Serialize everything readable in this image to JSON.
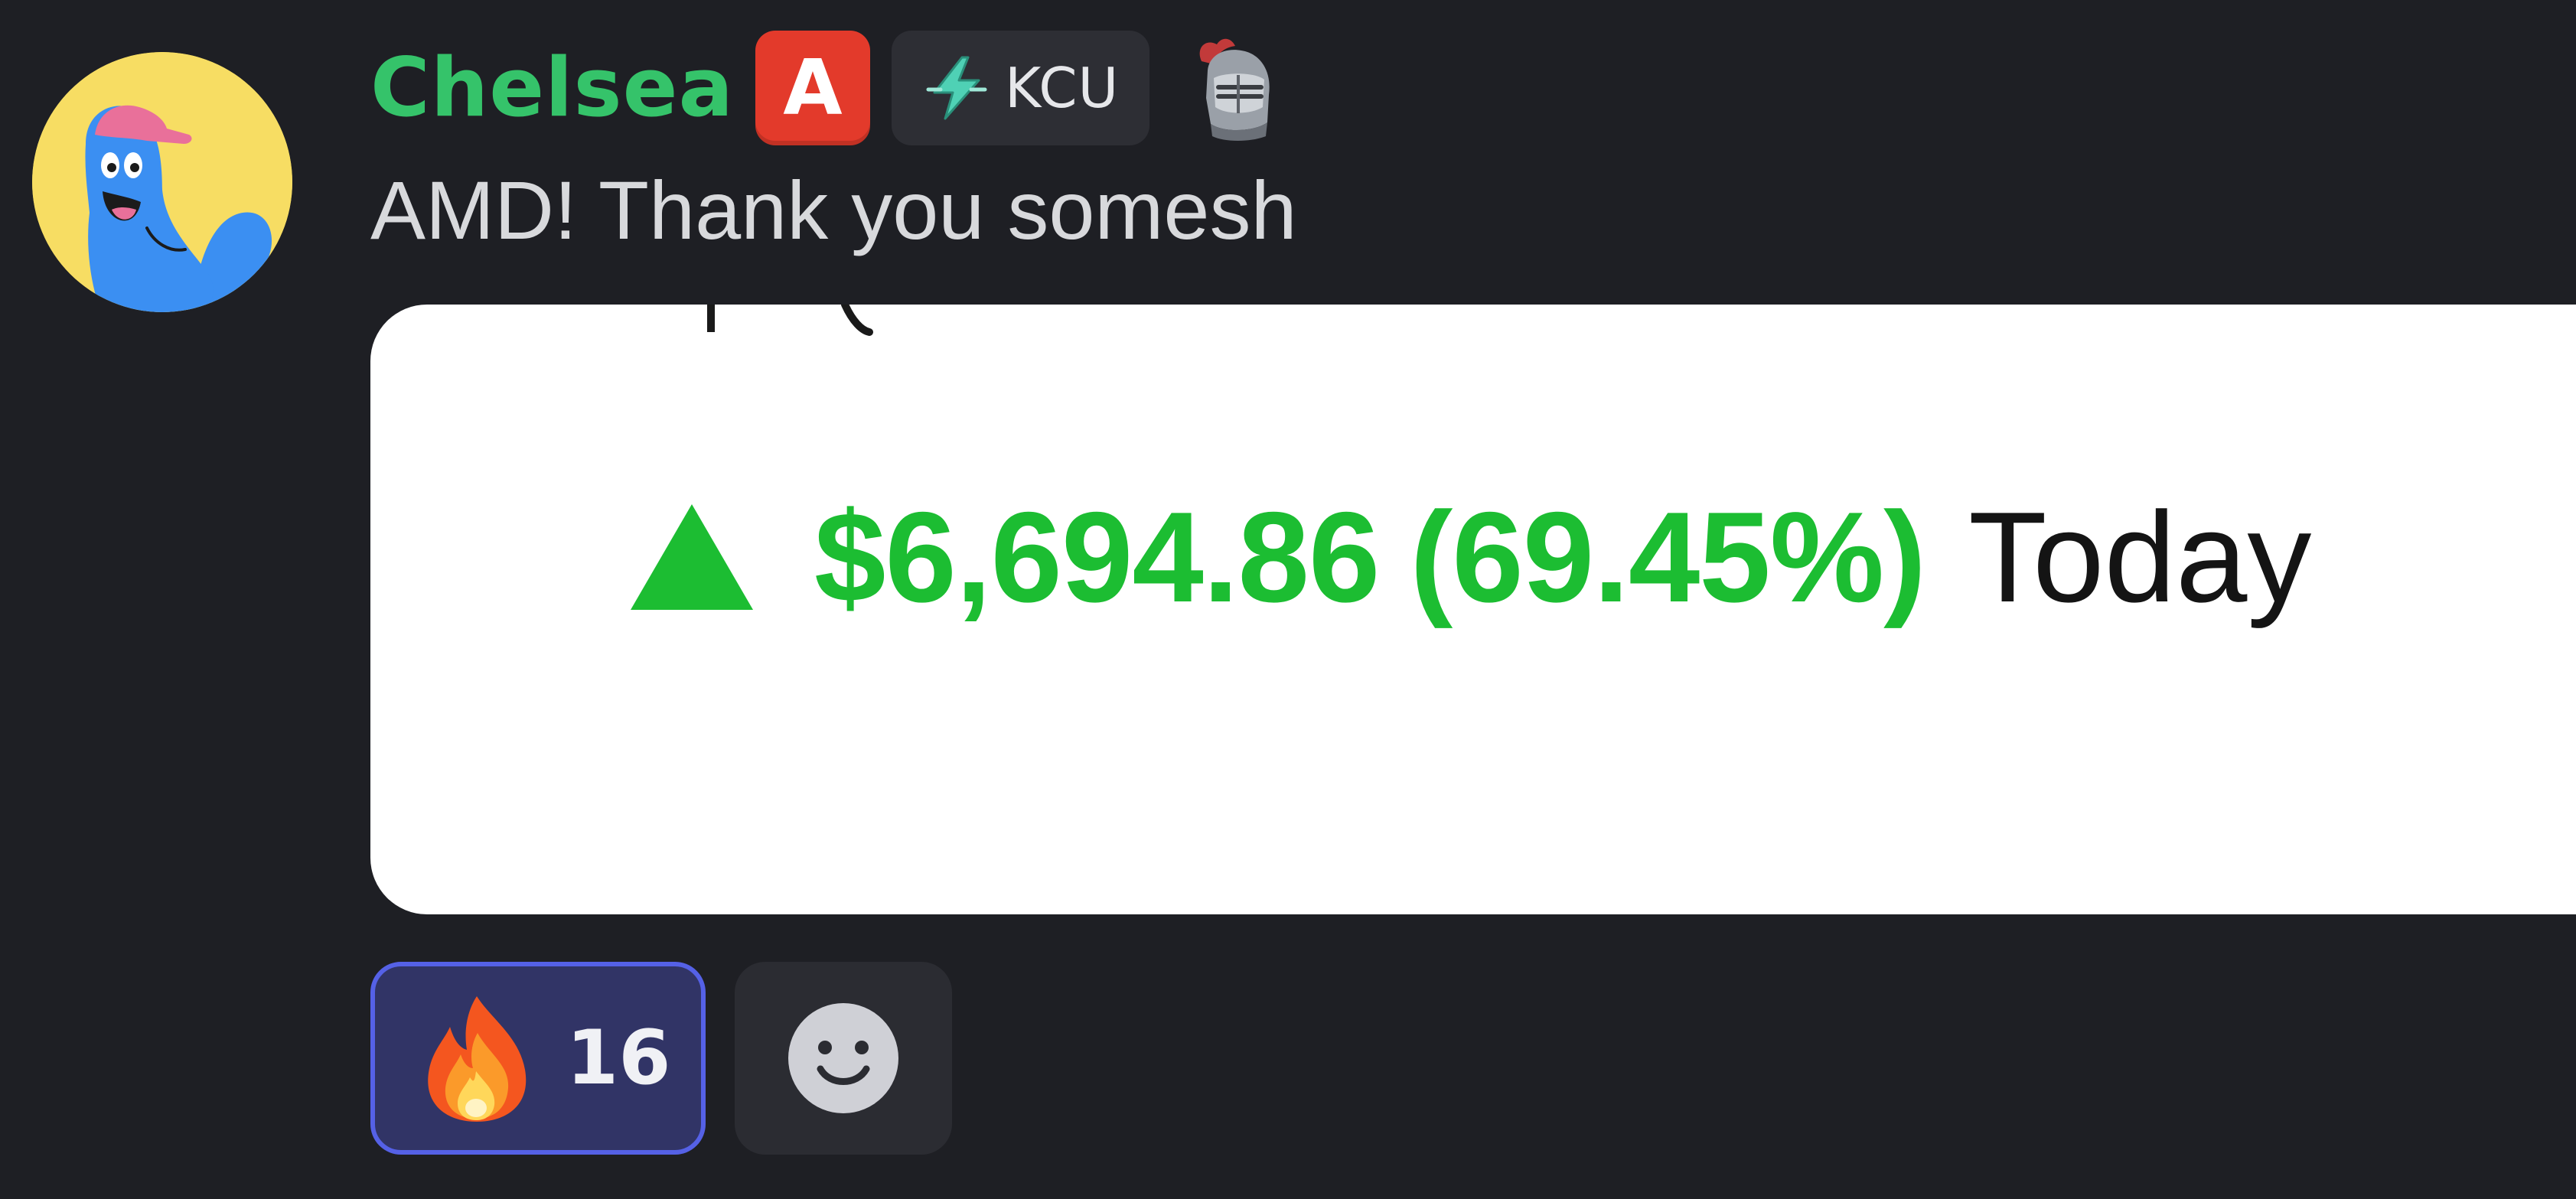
{
  "message": {
    "author": "Chelsea",
    "role_badge": "A",
    "tag": "KCU",
    "text": "AMD! Thank you somesh"
  },
  "attachment": {
    "gain_amount": "$6,694.86",
    "gain_percent": "(69.45%)",
    "gain_period": "Today",
    "gain_direction_icon": "triangle-up-icon"
  },
  "reactions": [
    {
      "emoji": "fire-icon",
      "count": "16",
      "reacted": true
    }
  ],
  "icons": {
    "avatar": "blue-monster-avatar",
    "tag": "lightning-bolt-icon",
    "extra_badge": "knight-helmet-icon",
    "add_reaction": "smiley-icon"
  },
  "colors": {
    "background": "#1e1f24",
    "username": "#35c36a",
    "role_badge": "#e33a2b",
    "gain_green": "#1cbd32",
    "reaction_bg": "#313466",
    "reaction_border": "#5561e6"
  }
}
